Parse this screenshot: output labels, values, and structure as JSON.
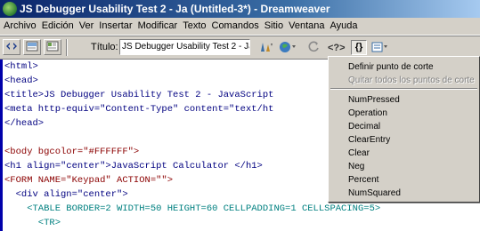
{
  "window": {
    "title": "JS Debugger Usability Test 2 - Ja (Untitled-3*) - Dreamweaver"
  },
  "menu": [
    "Archivo",
    "Edición",
    "Ver",
    "Insertar",
    "Modificar",
    "Texto",
    "Comandos",
    "Sitio",
    "Ventana",
    "Ayuda"
  ],
  "toolbar": {
    "title_label": "Título:",
    "title_value": "JS Debugger Usability Test 2 - Ja",
    "code_button_label": "<?>",
    "functions_button_label": "{}"
  },
  "code_lines": [
    "<html>",
    "<head>",
    "<title>JS Debugger Usability Test 2 - JavaScript",
    "<meta http-equiv=\"Content-Type\" content=\"text/ht",
    "</head>",
    "",
    "<body bgcolor=\"#FFFFFF\">",
    "<h1 align=\"center\">JavaScript Calculator </h1>",
    "<FORM NAME=\"Keypad\" ACTION=\"\">",
    "  <div align=\"center\">",
    "    <TABLE BORDER=2 WIDTH=50 HEIGHT=60 CELLPADDING=1 CELLSPACING=5>",
    "      <TR>"
  ],
  "dropdown": {
    "set_breakpoint": "Definir punto de corte",
    "remove_breakpoints": "Quitar todos los puntos de corte",
    "functions": [
      "NumPressed",
      "Operation",
      "Decimal",
      "ClearEntry",
      "Clear",
      "Neg",
      "Percent",
      "NumSquared"
    ]
  }
}
